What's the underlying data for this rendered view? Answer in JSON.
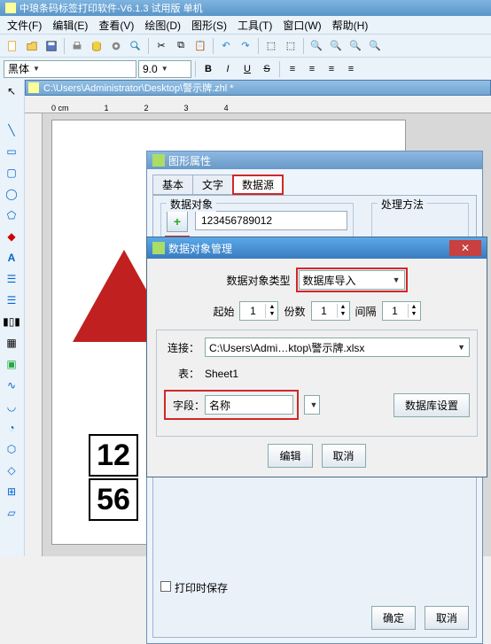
{
  "app": {
    "title": "中琅条码标签打印软件-V6.1.3 试用版 单机"
  },
  "menu": {
    "file": "文件(F)",
    "edit": "编辑(E)",
    "view": "查看(V)",
    "draw": "绘图(D)",
    "shape": "图形(S)",
    "tool": "工具(T)",
    "window": "窗口(W)",
    "help": "帮助(H)"
  },
  "fontbar": {
    "fontname": "黑体",
    "fontsize": "9.0",
    "b": "B",
    "i": "I",
    "u": "U",
    "s": "S"
  },
  "doc": {
    "path": "C:\\Users\\Administrator\\Desktop\\警示牌.zhl *"
  },
  "ruler": {
    "unit": "0 cm",
    "t1": "1",
    "t2": "2",
    "t3": "3",
    "t4": "4"
  },
  "canvas": {
    "box1": "12",
    "box2": "56"
  },
  "props": {
    "title": "图形属性",
    "tab_basic": "基本",
    "tab_text": "文字",
    "tab_data": "数据源",
    "group_objects": "数据对象",
    "group_methods": "处理方法",
    "objvalue": "123456789012"
  },
  "dom": {
    "title": "数据对象管理",
    "type_label": "数据对象类型",
    "type_value": "数据库导入",
    "start_label": "起始",
    "start_value": "1",
    "count_label": "份数",
    "count_value": "1",
    "gap_label": "间隔",
    "gap_value": "1",
    "conn_label": "连接：",
    "conn_value": "C:\\Users\\Admi…ktop\\警示牌.xlsx",
    "table_label": "表：",
    "table_value": "Sheet1",
    "field_label": "字段：",
    "field_value": "名称",
    "dbset_btn": "数据库设置",
    "edit_btn": "编辑",
    "cancel_btn": "取消",
    "printsave": "打印时保存",
    "ok_btn": "确定",
    "cancel2_btn": "取消"
  }
}
